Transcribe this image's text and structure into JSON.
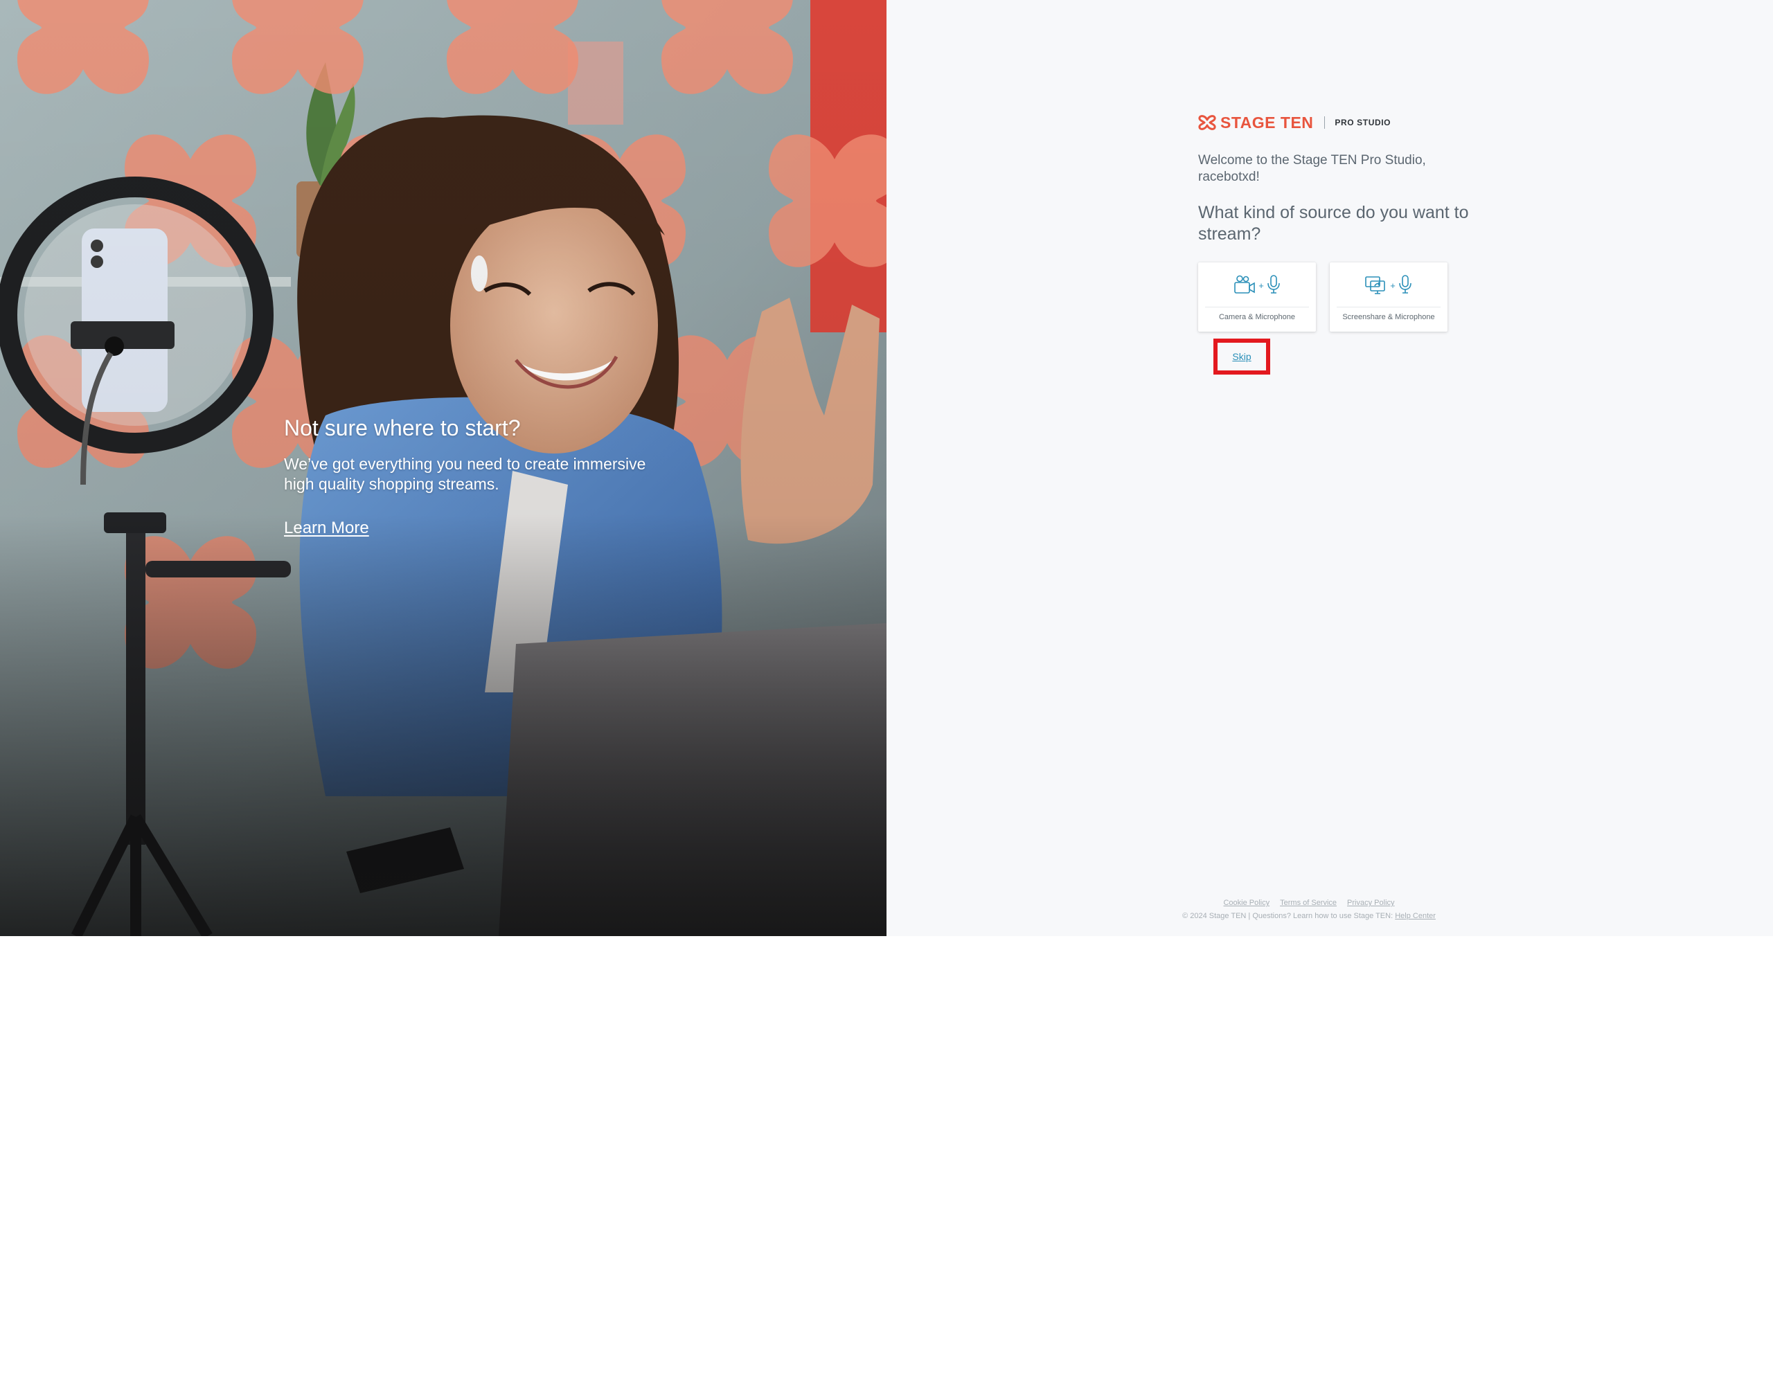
{
  "hero": {
    "title": "Not sure where to start?",
    "subtitle": "We’ve got everything you need to create immersive high quality shopping streams.",
    "link_label": "Learn More"
  },
  "brand": {
    "name": "STAGE TEN",
    "product": "PRO STUDIO",
    "color": "#e8553e"
  },
  "onboarding": {
    "welcome": "Welcome to the Stage TEN Pro Studio, racebotxd!",
    "question": "What kind of source do you want to stream?",
    "options": [
      {
        "label": "Camera & Microphone",
        "icons": [
          "camera-icon",
          "microphone-icon"
        ]
      },
      {
        "label": "Screenshare & Microphone",
        "icons": [
          "screenshare-icon",
          "microphone-icon"
        ]
      }
    ],
    "plus": "+",
    "skip_label": "Skip",
    "accent_color": "#2a8fb8",
    "highlight_color": "#e3191f"
  },
  "footer": {
    "links": [
      "Cookie Policy",
      "Terms of Service",
      "Privacy Policy"
    ],
    "copyright": "© 2024 Stage TEN | Questions? Learn how to use Stage TEN:",
    "help_label": "Help Center"
  }
}
